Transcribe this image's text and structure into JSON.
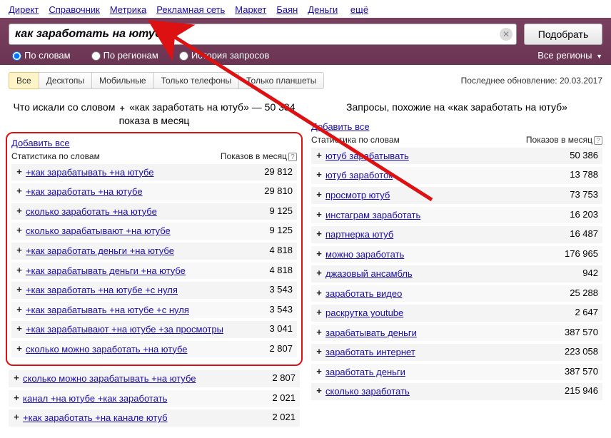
{
  "topnav": {
    "links": [
      "Директ",
      "Справочник",
      "Метрика",
      "Рекламная сеть",
      "Маркет",
      "Баян",
      "Деньги"
    ],
    "more": "ещё"
  },
  "search": {
    "value": "как заработать на ютуб",
    "submit": "Подобрать",
    "radios": {
      "words": "По словам",
      "regions": "По регионам",
      "history": "История запросов"
    },
    "all_regions": "Все регионы"
  },
  "tabs": {
    "items": [
      "Все",
      "Десктопы",
      "Мобильные",
      "Только телефоны",
      "Только планшеты"
    ],
    "active": 0
  },
  "last_update": "Последнее обновление: 20.03.2017",
  "left": {
    "heading_prefix": "Что искали со словом ",
    "heading_quote": "«как заработать на ютуб»",
    "heading_suffix": " — 50 384 показа в месяц",
    "add_all": "Добавить все",
    "col_kw": "Статистика по словам",
    "col_cnt": "Показов в месяц",
    "rows": [
      {
        "kw": "+как зарабатывать +на ютубе",
        "cnt": "29 812"
      },
      {
        "kw": "+как заработать +на ютубе",
        "cnt": "29 810"
      },
      {
        "kw": "сколько заработать +на ютубе",
        "cnt": "9 125"
      },
      {
        "kw": "сколько зарабатывают +на ютубе",
        "cnt": "9 125"
      },
      {
        "kw": "+как заработать деньги +на ютубе",
        "cnt": "4 818"
      },
      {
        "kw": "+как зарабатывать деньги +на ютубе",
        "cnt": "4 818"
      },
      {
        "kw": "+как заработать +на ютубе +с нуля",
        "cnt": "3 543"
      },
      {
        "kw": "+как зарабатывать +на ютубе +с нуля",
        "cnt": "3 543"
      },
      {
        "kw": "+как зарабатывают +на ютубе +за просмотры",
        "cnt": "3 041"
      },
      {
        "kw": "сколько можно заработать +на ютубе",
        "cnt": "2 807"
      }
    ],
    "extra_rows": [
      {
        "kw": "сколько можно зарабатывать +на ютубе",
        "cnt": "2 807"
      },
      {
        "kw": "канал +на ютубе +как заработать",
        "cnt": "2 021"
      },
      {
        "kw": "+как заработать +на канале ютуб",
        "cnt": "2 021"
      }
    ]
  },
  "right": {
    "heading_prefix": "Запросы, похожие на ",
    "heading_quote": "«как заработать на ютуб»",
    "add_all": "Добавить все",
    "col_kw": "Статистика по словам",
    "col_cnt": "Показов в месяц",
    "rows": [
      {
        "kw": "ютуб зарабатывать",
        "cnt": "50 386"
      },
      {
        "kw": "ютуб заработок",
        "cnt": "13 788"
      },
      {
        "kw": "просмотр ютуб",
        "cnt": "73 753"
      },
      {
        "kw": "инстаграм заработать",
        "cnt": "16 203"
      },
      {
        "kw": "партнерка ютуб",
        "cnt": "16 487"
      },
      {
        "kw": "можно заработать",
        "cnt": "176 965"
      },
      {
        "kw": "джазовый ансамбль",
        "cnt": "942"
      },
      {
        "kw": "заработать видео",
        "cnt": "25 288"
      },
      {
        "kw": "раскрутка youtube",
        "cnt": "2 647"
      },
      {
        "kw": "зарабатывать деньги",
        "cnt": "387 570"
      },
      {
        "kw": "заработать интернет",
        "cnt": "223 058"
      },
      {
        "kw": "заработать деньги",
        "cnt": "387 570"
      },
      {
        "kw": "сколько заработать",
        "cnt": "215 946"
      }
    ]
  }
}
